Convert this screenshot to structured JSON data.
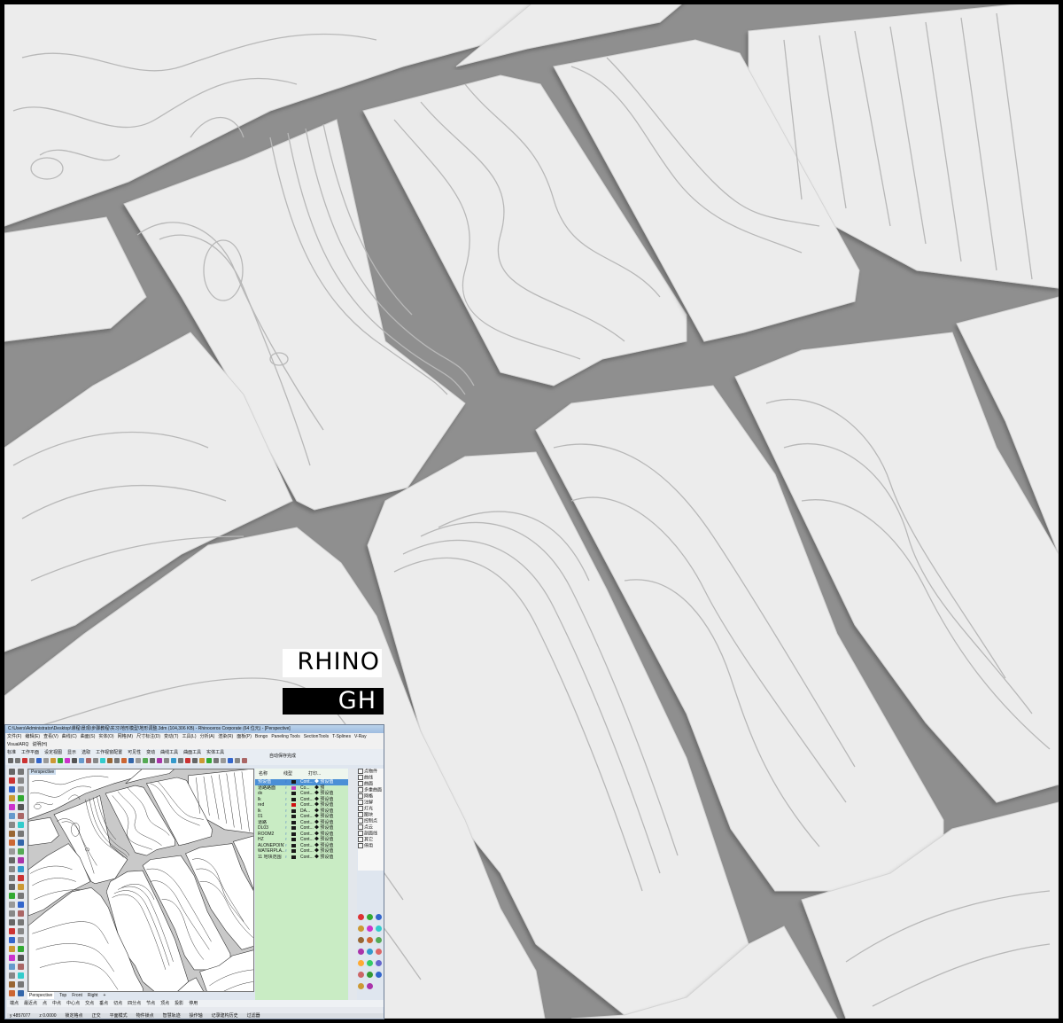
{
  "overlay": {
    "rhino_label": "RHINO",
    "gh_label": "GH"
  },
  "rhino_window": {
    "title": "C:\\Users\\Administrator\\Desktop\\课程\\景观\\步骤教程\\实习\\地形模型\\地形调整.3dm (104,306 KB) - Rhinoceros Corporate (64 位元) - [Perspective]",
    "menu_items": [
      "文件(F)",
      "编辑(E)",
      "查看(V)",
      "曲线(C)",
      "曲面(S)",
      "实体(O)",
      "网格(M)",
      "尺寸标注(D)",
      "变动(T)",
      "工具(L)",
      "分析(A)",
      "渲染(R)",
      "面板(P)",
      "Bongo",
      "Paneling Tools",
      "SectionTools",
      "T-Splines",
      "V-Ray",
      "VisualARQ",
      "说明(H)"
    ],
    "toolbar_tabs": [
      "标准",
      "工作平面",
      "设定视图",
      "显示",
      "选取",
      "工作视窗配置",
      "可见性",
      "变动",
      "曲线工具",
      "曲面工具",
      "实体工具"
    ],
    "command_text": "自动保存完成",
    "viewport_label": "Perspective",
    "viewport_tabs": [
      "Perspective",
      "Top",
      "Front",
      "Right",
      "+"
    ],
    "layer_panel": {
      "columns": [
        "名称",
        "线型",
        "打印..."
      ],
      "layers": [
        {
          "name": "预设值",
          "linetype": "Cont...",
          "print": "预设值",
          "selected": true,
          "color": "#1a1a1a"
        },
        {
          "name": "道路路面",
          "linetype": "Co...",
          "print": "预",
          "selected": false,
          "color": "#c040c0"
        },
        {
          "name": "dx",
          "linetype": "Cont...",
          "print": "预设值",
          "selected": false,
          "color": "#1a1a1a"
        },
        {
          "name": "lk",
          "linetype": "Cont...",
          "print": "预设值",
          "selected": false,
          "color": "#1a1a1a"
        },
        {
          "name": "red",
          "linetype": "Cont...",
          "print": "预设值",
          "selected": false,
          "color": "#d01010"
        },
        {
          "name": "lk",
          "linetype": "DA...",
          "print": "预设值",
          "selected": false,
          "color": "#1a1a1a"
        },
        {
          "name": "01",
          "linetype": "Cont...",
          "print": "预设值",
          "selected": false,
          "color": "#1a1a1a"
        },
        {
          "name": "道路",
          "linetype": "Cont...",
          "print": "预设值",
          "selected": false,
          "color": "#1a1a1a"
        },
        {
          "name": "DL03",
          "linetype": "Cont...",
          "print": "预设值",
          "selected": false,
          "color": "#1a1a1a"
        },
        {
          "name": "ROOM2",
          "linetype": "Cont...",
          "print": "预设值",
          "selected": false,
          "color": "#1a1a1a"
        },
        {
          "name": "HZ",
          "linetype": "Cont...",
          "print": "预设值",
          "selected": false,
          "color": "#1a1a1a"
        },
        {
          "name": "ALONEPOINT",
          "linetype": "Cont...",
          "print": "预设值",
          "selected": false,
          "color": "#1a1a1a"
        },
        {
          "name": "WATERPLA...",
          "linetype": "Cont...",
          "print": "预设值",
          "selected": false,
          "color": "#1a1a1a"
        },
        {
          "name": "11 地块范围",
          "linetype": "Cont...",
          "print": "预设值",
          "selected": false,
          "color": "#1a1a1a"
        }
      ]
    },
    "display_checks": [
      "点物件",
      "曲线",
      "曲面",
      "多重曲面",
      "网格",
      "注解",
      "灯光",
      "图块",
      "控制点",
      "点云",
      "剖面线",
      "其它",
      "停用"
    ],
    "osnap_items": [
      "端点",
      "最近点",
      "点",
      "中点",
      "中心点",
      "交点",
      "垂点",
      "切点",
      "四分点",
      "节点",
      "顶点",
      "投影",
      "停用"
    ],
    "status_values": [
      "y 4857077",
      "z 0.0000"
    ],
    "status_items": [
      "锁定格点",
      "正交",
      "平面模式",
      "物件锁点",
      "智慧轨迹",
      "操作轴",
      "记录建构历史",
      "过滤器"
    ]
  }
}
